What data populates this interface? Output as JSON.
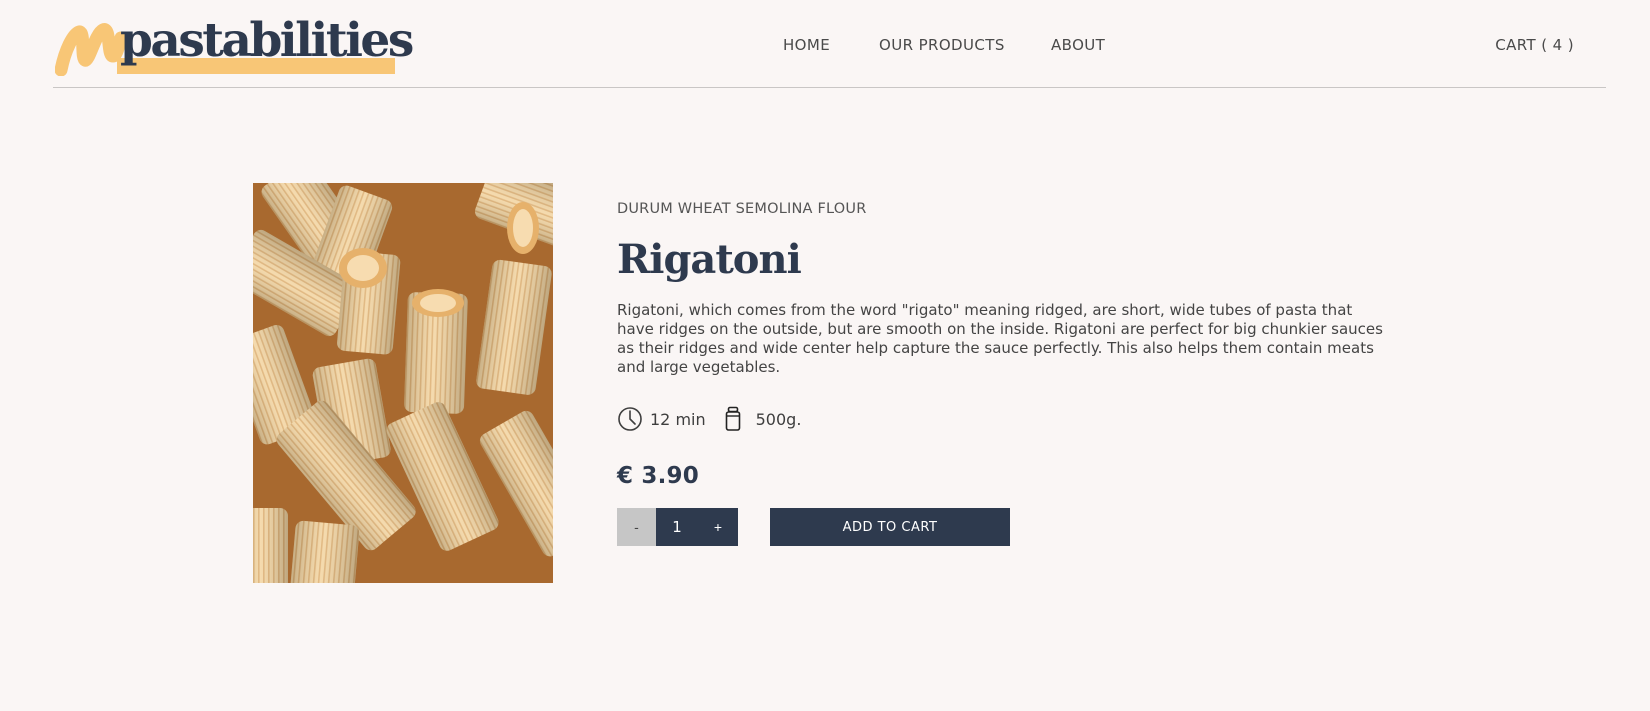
{
  "brand": {
    "name": "pastabilities",
    "highlight_color": "#f8c676",
    "text_color": "#2e3a4e"
  },
  "nav": {
    "links": [
      {
        "label": "HOME"
      },
      {
        "label": "OUR PRODUCTS"
      },
      {
        "label": "ABOUT"
      }
    ],
    "cart_label": "CART ( 4 )"
  },
  "product": {
    "category": "DURUM WHEAT SEMOLINA FLOUR",
    "name": "Rigatoni",
    "description": "Rigatoni, which comes from the word \"rigato\" meaning ridged, are short, wide tubes of pasta that have ridges on the outside, but are smooth on the inside. Rigatoni are perfect for big chunkier sauces as their ridges and wide center help capture the sauce perfectly. This also helps them contain meats and large vegetables.",
    "cook_time": "12 min",
    "cook_time_icon": "clock-icon",
    "weight": "500g.",
    "weight_icon": "jar-icon",
    "price": "€ 3.90",
    "image_icon": "rigatoni-photo"
  },
  "cart_controls": {
    "minus_label": "-",
    "quantity": "1",
    "plus_label": "+",
    "add_label": "ADD TO CART"
  },
  "colors": {
    "background": "#faf6f5",
    "primary": "#2e3a4e",
    "disabled": "#c6c6c6"
  }
}
